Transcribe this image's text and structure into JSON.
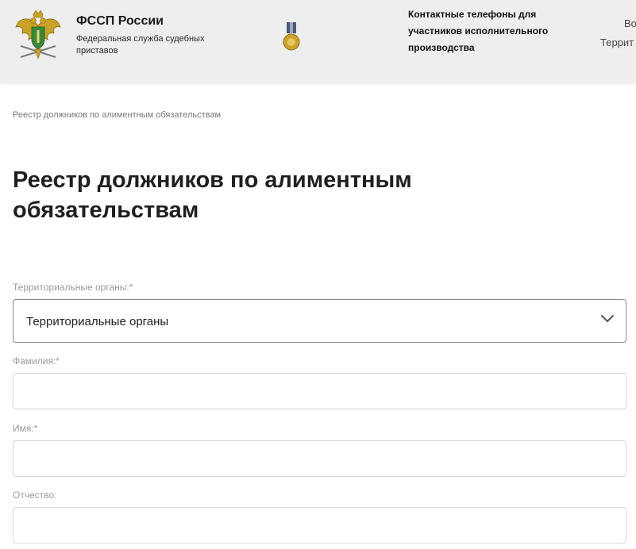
{
  "header": {
    "brand_title": "ФССП России",
    "brand_subtitle": "Федеральная служба судебных приставов",
    "contacts_text": "Контактные телефоны для участников исполнительного производства",
    "right_cut_line1": "Во",
    "right_cut_line2": "Террит"
  },
  "breadcrumb": {
    "current": "Реестр должников по алиментным обязательствам"
  },
  "page": {
    "title": "Реестр должников по алиментным обязательствам"
  },
  "form": {
    "territorial": {
      "label": "Территориальные органы:*",
      "selected": "Территориальные органы"
    },
    "lastname": {
      "label": "Фамилия:*",
      "value": ""
    },
    "firstname": {
      "label": "Имя:*",
      "value": ""
    },
    "patronymic": {
      "label": "Отчество:",
      "value": ""
    }
  },
  "colors": {
    "header_bg": "#eeeeee",
    "label_gray": "#9a9a9a",
    "emblem_gold": "#c9a227",
    "emblem_green": "#3a8a3a"
  },
  "icons": {
    "logo": "fssp-eagle-emblem-icon",
    "medal": "medal-icon",
    "dropdown": "chevron-down-icon"
  }
}
